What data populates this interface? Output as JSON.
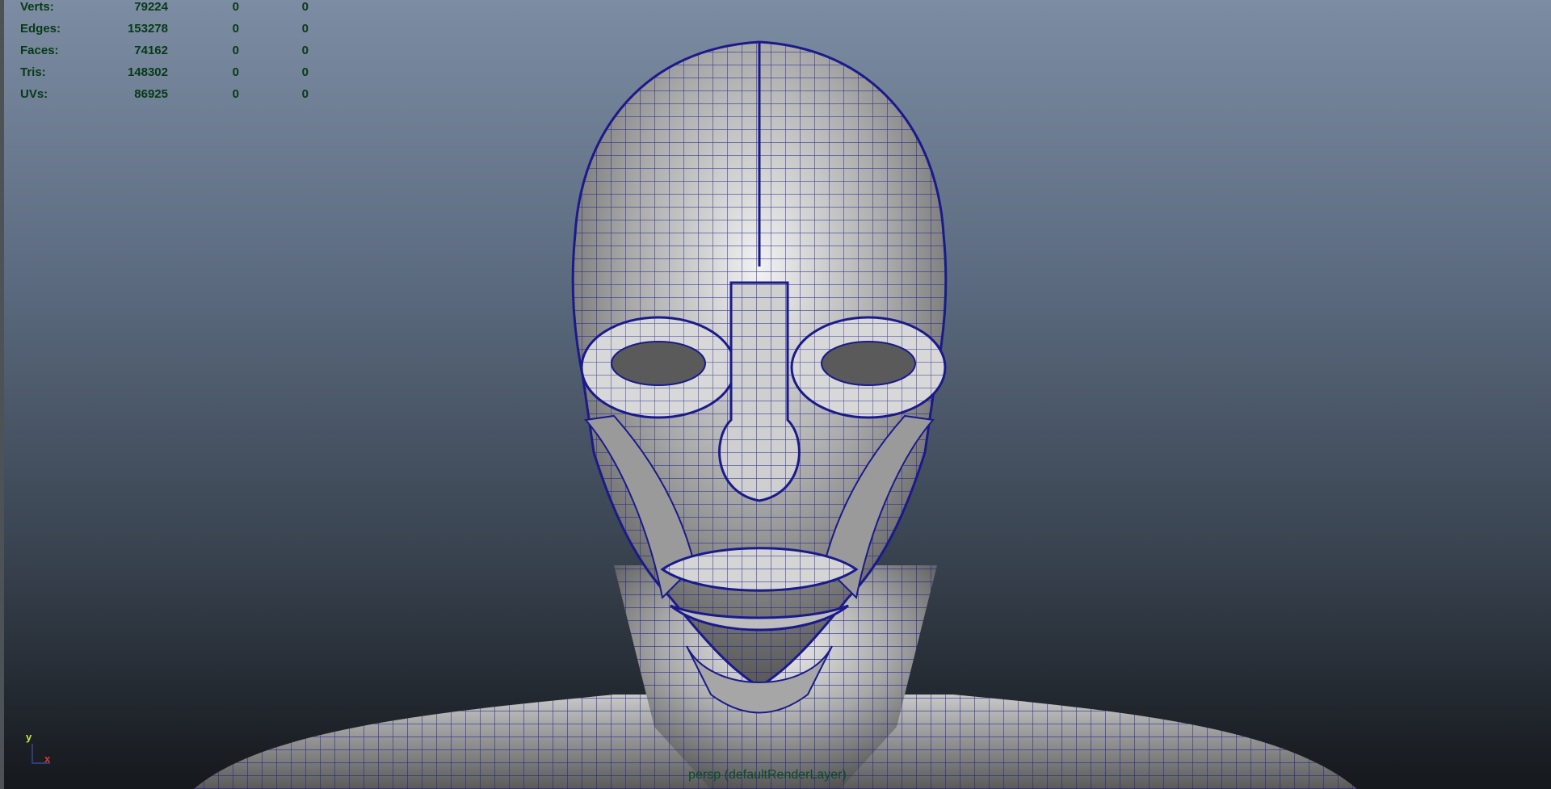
{
  "hud": {
    "rows": [
      {
        "label": "Verts:",
        "c1": "79224",
        "c2": "0",
        "c3": "0"
      },
      {
        "label": "Edges:",
        "c1": "153278",
        "c2": "0",
        "c3": "0"
      },
      {
        "label": "Faces:",
        "c1": "74162",
        "c2": "0",
        "c3": "0"
      },
      {
        "label": "Tris:",
        "c1": "148302",
        "c2": "0",
        "c3": "0"
      },
      {
        "label": "UVs:",
        "c1": "86925",
        "c2": "0",
        "c3": "0"
      }
    ]
  },
  "viewport": {
    "camera_label": "persp (defaultRenderLayer)",
    "wire_color": "#1a1a8c"
  },
  "axis": {
    "y": "y",
    "x": "x"
  }
}
